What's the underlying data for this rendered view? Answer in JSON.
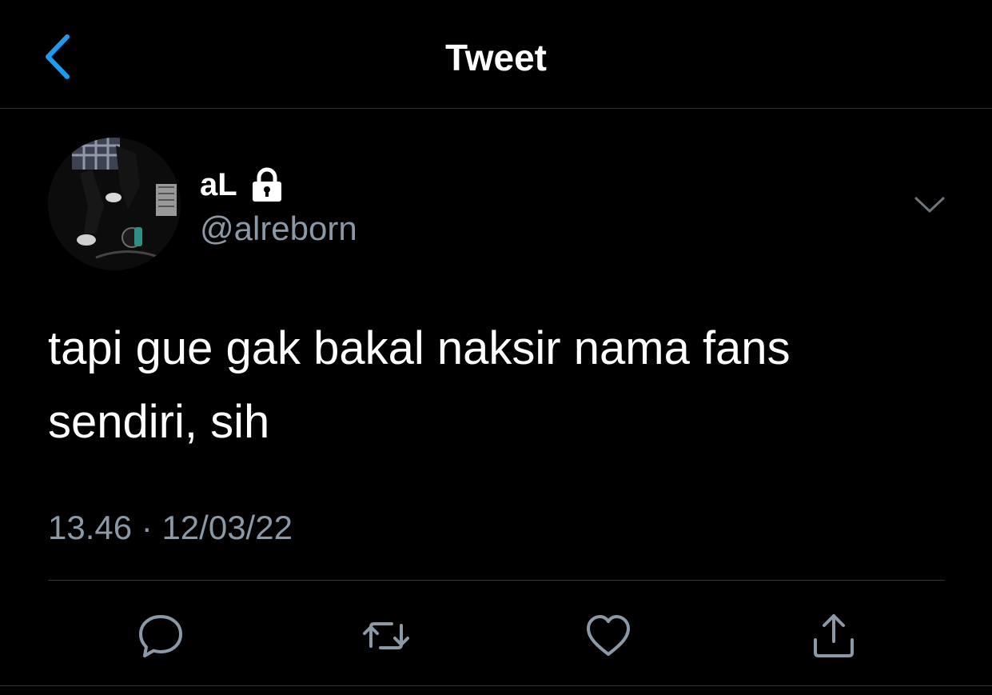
{
  "header": {
    "title": "Tweet",
    "back_icon": "chevron-left-icon",
    "accent_color": "#1d9bf0"
  },
  "tweet": {
    "author": {
      "display_name": "aL",
      "handle": "@alreborn",
      "protected_icon": "lock-icon",
      "avatar": "avatar-photo"
    },
    "text": "tapi gue gak bakal naksir nama fans\nsendiri, sih",
    "time": "13.46",
    "separator": "·",
    "date": "12/03/22",
    "menu_icon": "chevron-down-icon"
  },
  "actions": [
    {
      "name": "reply",
      "icon": "reply-icon"
    },
    {
      "name": "retweet",
      "icon": "retweet-icon"
    },
    {
      "name": "like",
      "icon": "heart-icon"
    },
    {
      "name": "share",
      "icon": "share-icon"
    }
  ],
  "colors": {
    "background": "#000000",
    "text": "#ffffff",
    "secondary_text": "#8b98a5",
    "divider": "#2f3336"
  }
}
